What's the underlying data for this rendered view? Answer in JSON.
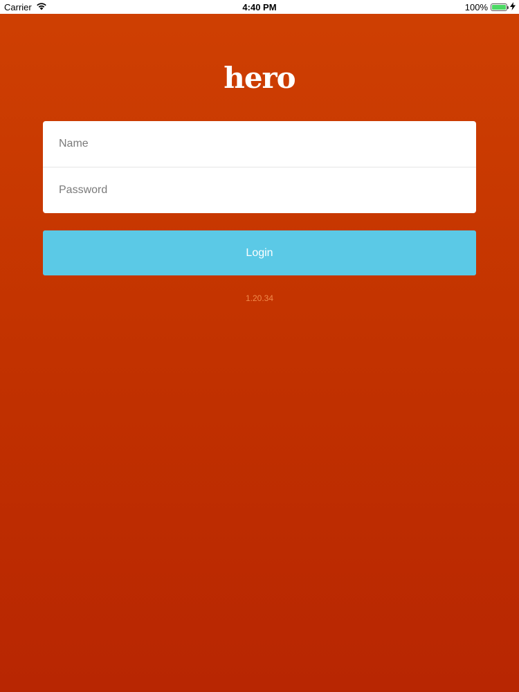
{
  "status_bar": {
    "carrier": "Carrier",
    "time": "4:40 PM",
    "battery_percent": "100%",
    "battery_level": 1.0,
    "wifi_icon": "wifi-icon",
    "charging_icon": "bolt-icon"
  },
  "app": {
    "logo_text": "hero"
  },
  "form": {
    "name_placeholder": "Name",
    "name_value": "",
    "password_placeholder": "Password",
    "password_value": "",
    "login_label": "Login"
  },
  "version": "1.20.34",
  "colors": {
    "background_top": "#cf4002",
    "background_bottom": "#b82602",
    "button": "#5bc9e6",
    "card": "#ffffff",
    "version_text": "#f08a4a"
  }
}
